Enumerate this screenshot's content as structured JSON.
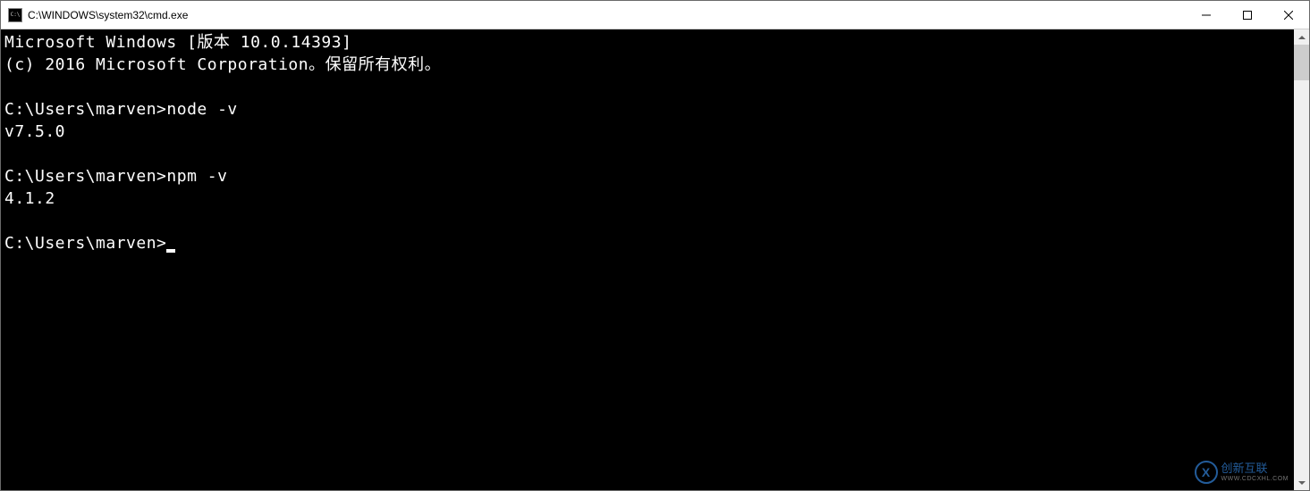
{
  "window": {
    "title": "C:\\WINDOWS\\system32\\cmd.exe"
  },
  "terminal": {
    "header_line1": "Microsoft Windows [版本 10.0.14393]",
    "header_line2": "(c) 2016 Microsoft Corporation。保留所有权利。",
    "blank": "",
    "prompt": "C:\\Users\\marven>",
    "command1": "node -v",
    "output1": "v7.5.0",
    "command2": "npm -v",
    "output2": "4.1.2"
  },
  "watermark": {
    "brand": "创新互联",
    "sub": "WWW.CDCXHL.COM"
  }
}
